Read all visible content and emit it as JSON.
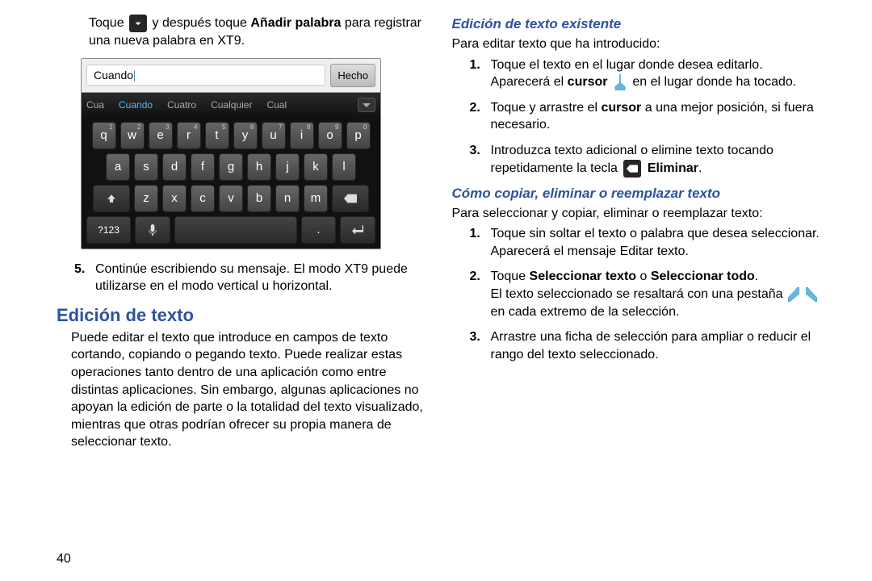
{
  "page_number": "40",
  "left": {
    "intro_pre": "Toque",
    "intro_mid": "y después toque",
    "intro_bold": "Añadir palabra",
    "intro_post": "para registrar una nueva palabra en XT9.",
    "keyboard": {
      "input_value": "Cuando",
      "done_label": "Hecho",
      "suggestions": [
        "Cua",
        "Cuando",
        "Cuatro",
        "Cualquier",
        "Cual"
      ],
      "row1": [
        "q",
        "w",
        "e",
        "r",
        "t",
        "y",
        "u",
        "i",
        "o",
        "p"
      ],
      "row1_sup": [
        "1",
        "2",
        "3",
        "4",
        "5",
        "6",
        "7",
        "8",
        "9",
        "0"
      ],
      "row2": [
        "a",
        "s",
        "d",
        "f",
        "g",
        "h",
        "j",
        "k",
        "l"
      ],
      "row3_shift": "⇧",
      "row3": [
        "z",
        "x",
        "c",
        "v",
        "b",
        "n",
        "m"
      ],
      "label_123": "?123"
    },
    "item5_num": "5.",
    "item5": "Continúe escribiendo su mensaje. El modo XT9 puede utilizarse en el modo vertical u horizontal.",
    "heading": "Edición de texto",
    "body": "Puede editar el texto que introduce en campos de texto cortando, copiando o pegando texto. Puede realizar estas operaciones tanto dentro de una aplicación como entre distintas aplicaciones. Sin embargo, algunas aplicaciones no apoyan la edición de parte o la totalidad del texto visualizado, mientras que otras podrían ofrecer su propia manera de seleccionar texto."
  },
  "right": {
    "h1": "Edición de texto existente",
    "intro1": "Para editar texto que ha introducido:",
    "l1_num": "1.",
    "l1a": "Toque el texto en el lugar donde desea editarlo.",
    "l1b_pre": "Aparecerá el",
    "l1b_bold": "cursor",
    "l1b_post": "en el lugar donde ha tocado.",
    "l2_num": "2.",
    "l2_pre": "Toque y arrastre el",
    "l2_bold": "cursor",
    "l2_post": "a una mejor posición, si fuera necesario.",
    "l3_num": "3.",
    "l3_pre": "Introduzca texto adicional o elimine texto tocando repetidamente la tecla",
    "l3_bold": "Eliminar",
    "l3_dot": ".",
    "h2": "Cómo copiar, eliminar o reemplazar texto",
    "intro2": "Para seleccionar y copiar, eliminar o reemplazar texto:",
    "m1_num": "1.",
    "m1a": "Toque sin soltar el texto o palabra que desea seleccionar.",
    "m1b": "Aparecerá el mensaje Editar texto.",
    "m2_num": "2.",
    "m2_pre": "Toque",
    "m2_bold1": "Seleccionar texto",
    "m2_o": "o",
    "m2_bold2": "Seleccionar todo",
    "m2_dot": ".",
    "m2c_pre": "El texto seleccionado se resaltará con una pestaña",
    "m2c_post": "en cada extremo de la selección.",
    "m3_num": "3.",
    "m3": "Arrastre una ficha de selección para ampliar o reducir el rango del texto seleccionado."
  }
}
